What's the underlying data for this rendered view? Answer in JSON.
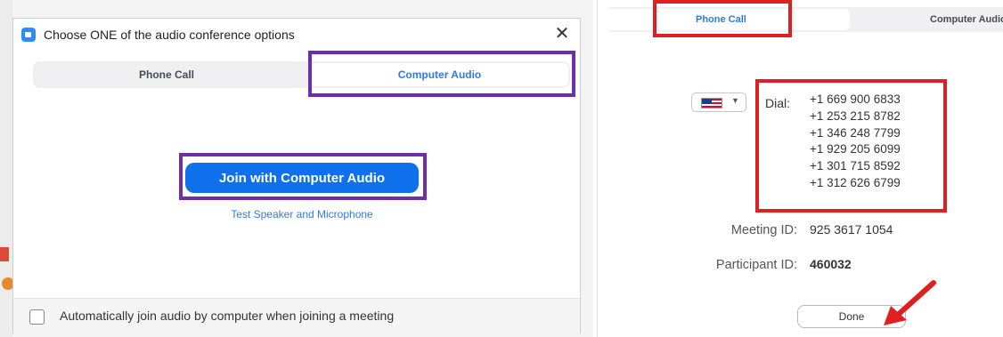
{
  "dialog": {
    "title": "Choose ONE of the audio conference options",
    "close_glyph": "✕",
    "tabs": [
      {
        "label": "Phone Call"
      },
      {
        "label": "Computer Audio"
      }
    ],
    "join_button_label": "Join with Computer Audio",
    "test_link_label": "Test Speaker and Microphone",
    "auto_join_label": "Automatically join audio by computer when joining a meeting"
  },
  "phone_panel": {
    "tabs": [
      {
        "label": "Phone Call"
      },
      {
        "label": "Computer Audio"
      }
    ],
    "dial_label": "Dial:",
    "dial_numbers": [
      "+1 669 900 6833",
      "+1 253 215 8782",
      "+1 346 248 7799",
      "+1 929 205 6099",
      "+1 301 715 8592",
      "+1 312 626 6799"
    ],
    "meeting_id_label": "Meeting ID:",
    "meeting_id": "925 3617 1054",
    "participant_id_label": "Participant ID:",
    "participant_id": "460032",
    "done_label": "Done"
  },
  "icons": {
    "app": "zoom-icon",
    "close": "close-icon",
    "flag": "us-flag-icon",
    "dropdown": "chevron-down-icon",
    "annotation": "red-arrow-icon"
  },
  "colors": {
    "accent_blue": "#0e71eb",
    "link_blue": "#2d7be5",
    "highlight_purple": "#6f2da8",
    "highlight_red": "#e02020"
  }
}
